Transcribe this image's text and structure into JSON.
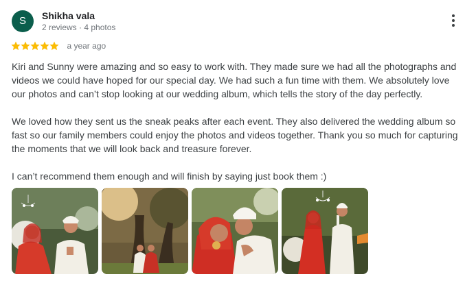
{
  "reviewer": {
    "initial": "S",
    "name": "Shikha vala",
    "meta": "2 reviews · 4 photos",
    "avatar_color": "#0b5e4c"
  },
  "rating": {
    "stars": 5,
    "max": 5,
    "star_color": "#fbbc04",
    "time_ago": "a year ago"
  },
  "review": {
    "paragraphs": [
      "Kiri and Sunny were amazing and so easy to work with. They made sure we had all the photographs and videos we could have hoped for our special day. We had such a fun time with them. We absolutely love our photos and can’t stop looking at our wedding album, which tells the story of the day perfectly.",
      "We loved how they sent us the sneak peaks after each event. They also delivered the wedding album so fast so our family members could enjoy the photos and videos together. Thank you so much for capturing the moments that we will look back and treasure forever.",
      "I can’t recommend them enough and will finish by saying just book them :)"
    ]
  },
  "menu": {
    "icon": "more-vert-icon"
  },
  "photos": {
    "count": 4,
    "items": [
      "wedding-photo",
      "wedding-photo",
      "wedding-photo",
      "wedding-photo"
    ]
  }
}
